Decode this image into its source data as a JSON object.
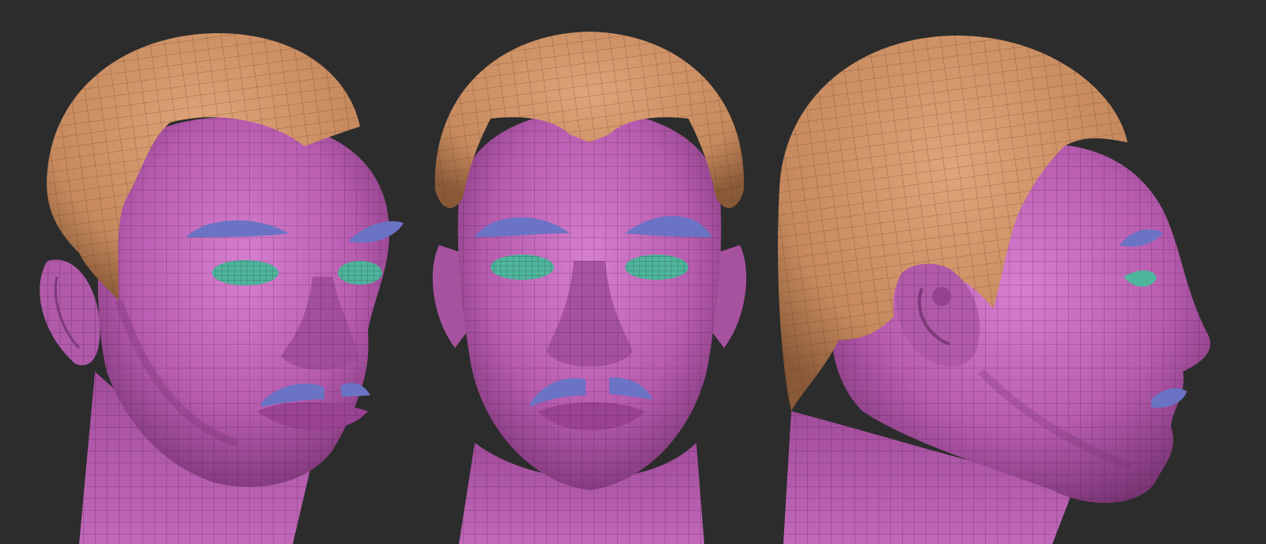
{
  "scene": {
    "background_color": "#2c2c2c",
    "views": [
      {
        "view": "three-quarter-left"
      },
      {
        "view": "front"
      },
      {
        "view": "profile-right"
      }
    ]
  },
  "materials": {
    "skin": "#b85cb0",
    "skin_light": "#d77fd0",
    "skin_dark": "#7a3475",
    "hair": "#c68a5e",
    "hair_light": "#e0a47a",
    "hair_dark": "#8a5a38",
    "brow_mustache": "#6a73c4",
    "eye": "#4fb59c",
    "wire": "#3a1838"
  }
}
